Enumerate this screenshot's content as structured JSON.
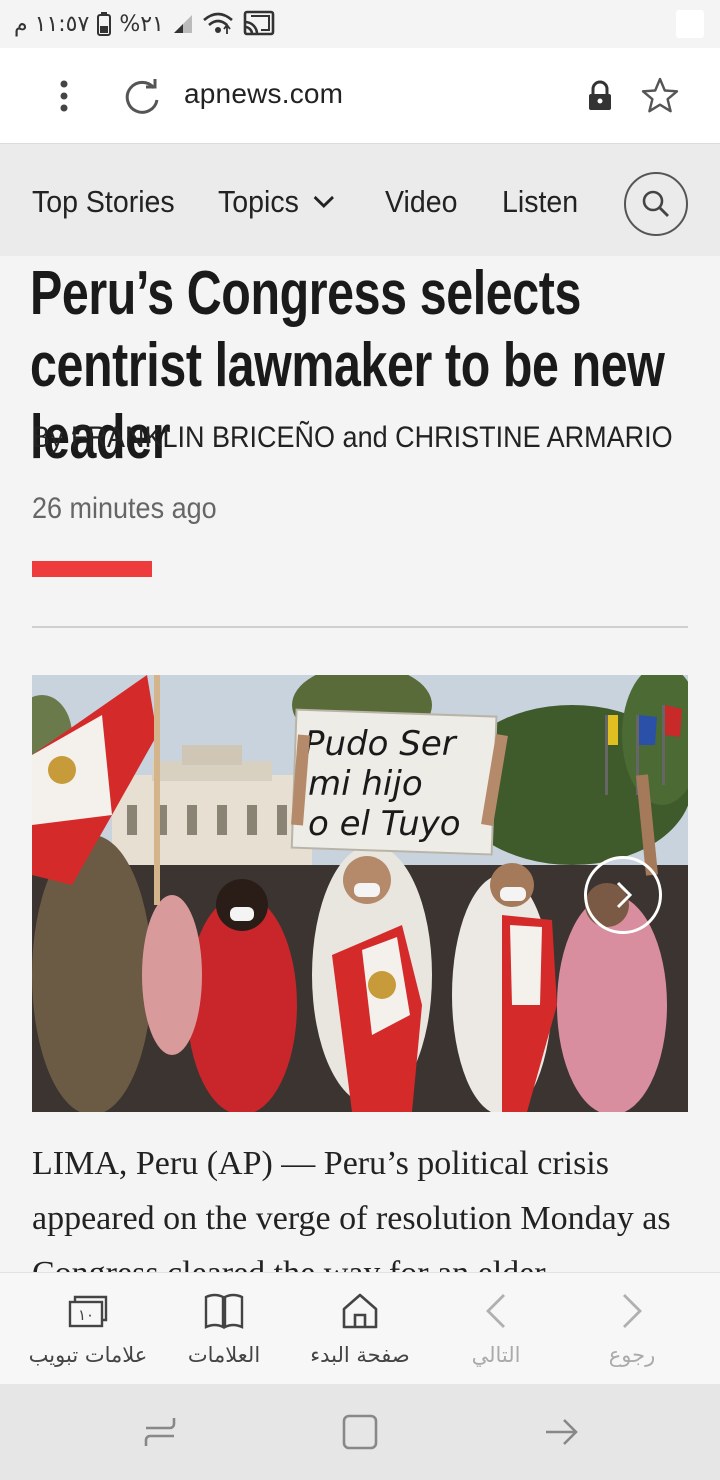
{
  "status_bar": {
    "time": "١١:٥٧ م",
    "battery": "%٢١"
  },
  "browser": {
    "url": "apnews.com"
  },
  "site_nav": {
    "items": [
      {
        "label": "Top Stories"
      },
      {
        "label": "Topics"
      },
      {
        "label": "Video"
      },
      {
        "label": "Listen"
      }
    ]
  },
  "article": {
    "headline": "Peru’s Congress selects centrist lawmaker to be new leader",
    "byline": "By FRANKLIN BRICEÑO and CHRISTINE ARMARIO",
    "timestamp": "26 minutes ago",
    "photo_sign_text": [
      "Pudo Ser",
      "mi hijo",
      "o el Tuyo"
    ],
    "body_text": "LIMA, Peru (AP) — Peru’s political crisis appeared on the verge of resolution Monday as Congress cleared the way for an elder"
  },
  "accent_color": "#ee3b3b",
  "bottom_toolbar": {
    "items": [
      {
        "label": "علامات تبويب",
        "icon": "tabs-icon",
        "badge": "١٠"
      },
      {
        "label": "العلامات",
        "icon": "bookmarks-icon"
      },
      {
        "label": "صفحة البدء",
        "icon": "home-icon"
      },
      {
        "label": "التالي",
        "icon": "chevron-left-icon"
      },
      {
        "label": "رجوع",
        "icon": "chevron-right-icon"
      }
    ]
  }
}
